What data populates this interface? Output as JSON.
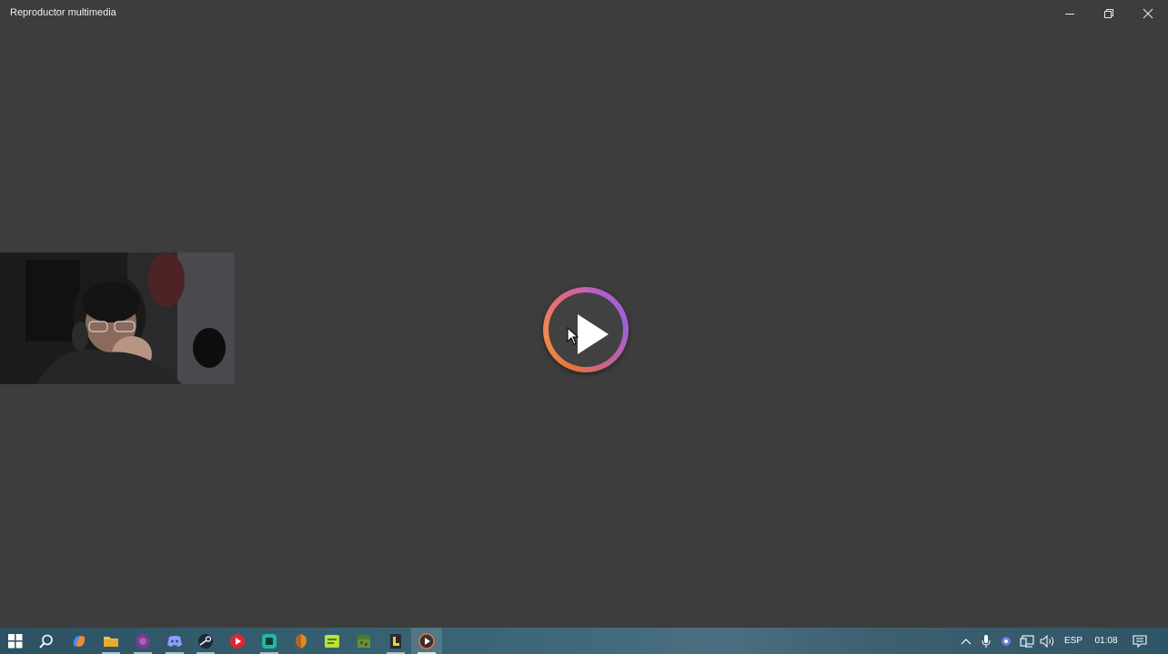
{
  "window": {
    "title": "Reproductor multimedia",
    "controls": [
      "minimize",
      "maximize",
      "close"
    ]
  },
  "player": {
    "state": "paused",
    "play_button_icon": "play-icon",
    "accent_gradient": [
      "#e7753a",
      "#e56a84",
      "#9a62d9"
    ]
  },
  "taskbar": {
    "apps": [
      {
        "name": "start-icon"
      },
      {
        "name": "search-icon"
      },
      {
        "name": "copilot-icon"
      },
      {
        "name": "file-explorer-icon"
      },
      {
        "name": "app-purple-icon"
      },
      {
        "name": "discord-icon"
      },
      {
        "name": "steam-icon"
      },
      {
        "name": "red-app-icon"
      },
      {
        "name": "teal-app-icon"
      },
      {
        "name": "orange-shield-icon"
      },
      {
        "name": "green-app-icon"
      },
      {
        "name": "minecraft-icon"
      },
      {
        "name": "terminal-app-icon"
      },
      {
        "name": "media-player-icon"
      }
    ],
    "tray": {
      "language": "ESP",
      "time": "01:08"
    }
  },
  "colors": {
    "background": "#3d3d3d",
    "taskbar": "#3a6475"
  }
}
